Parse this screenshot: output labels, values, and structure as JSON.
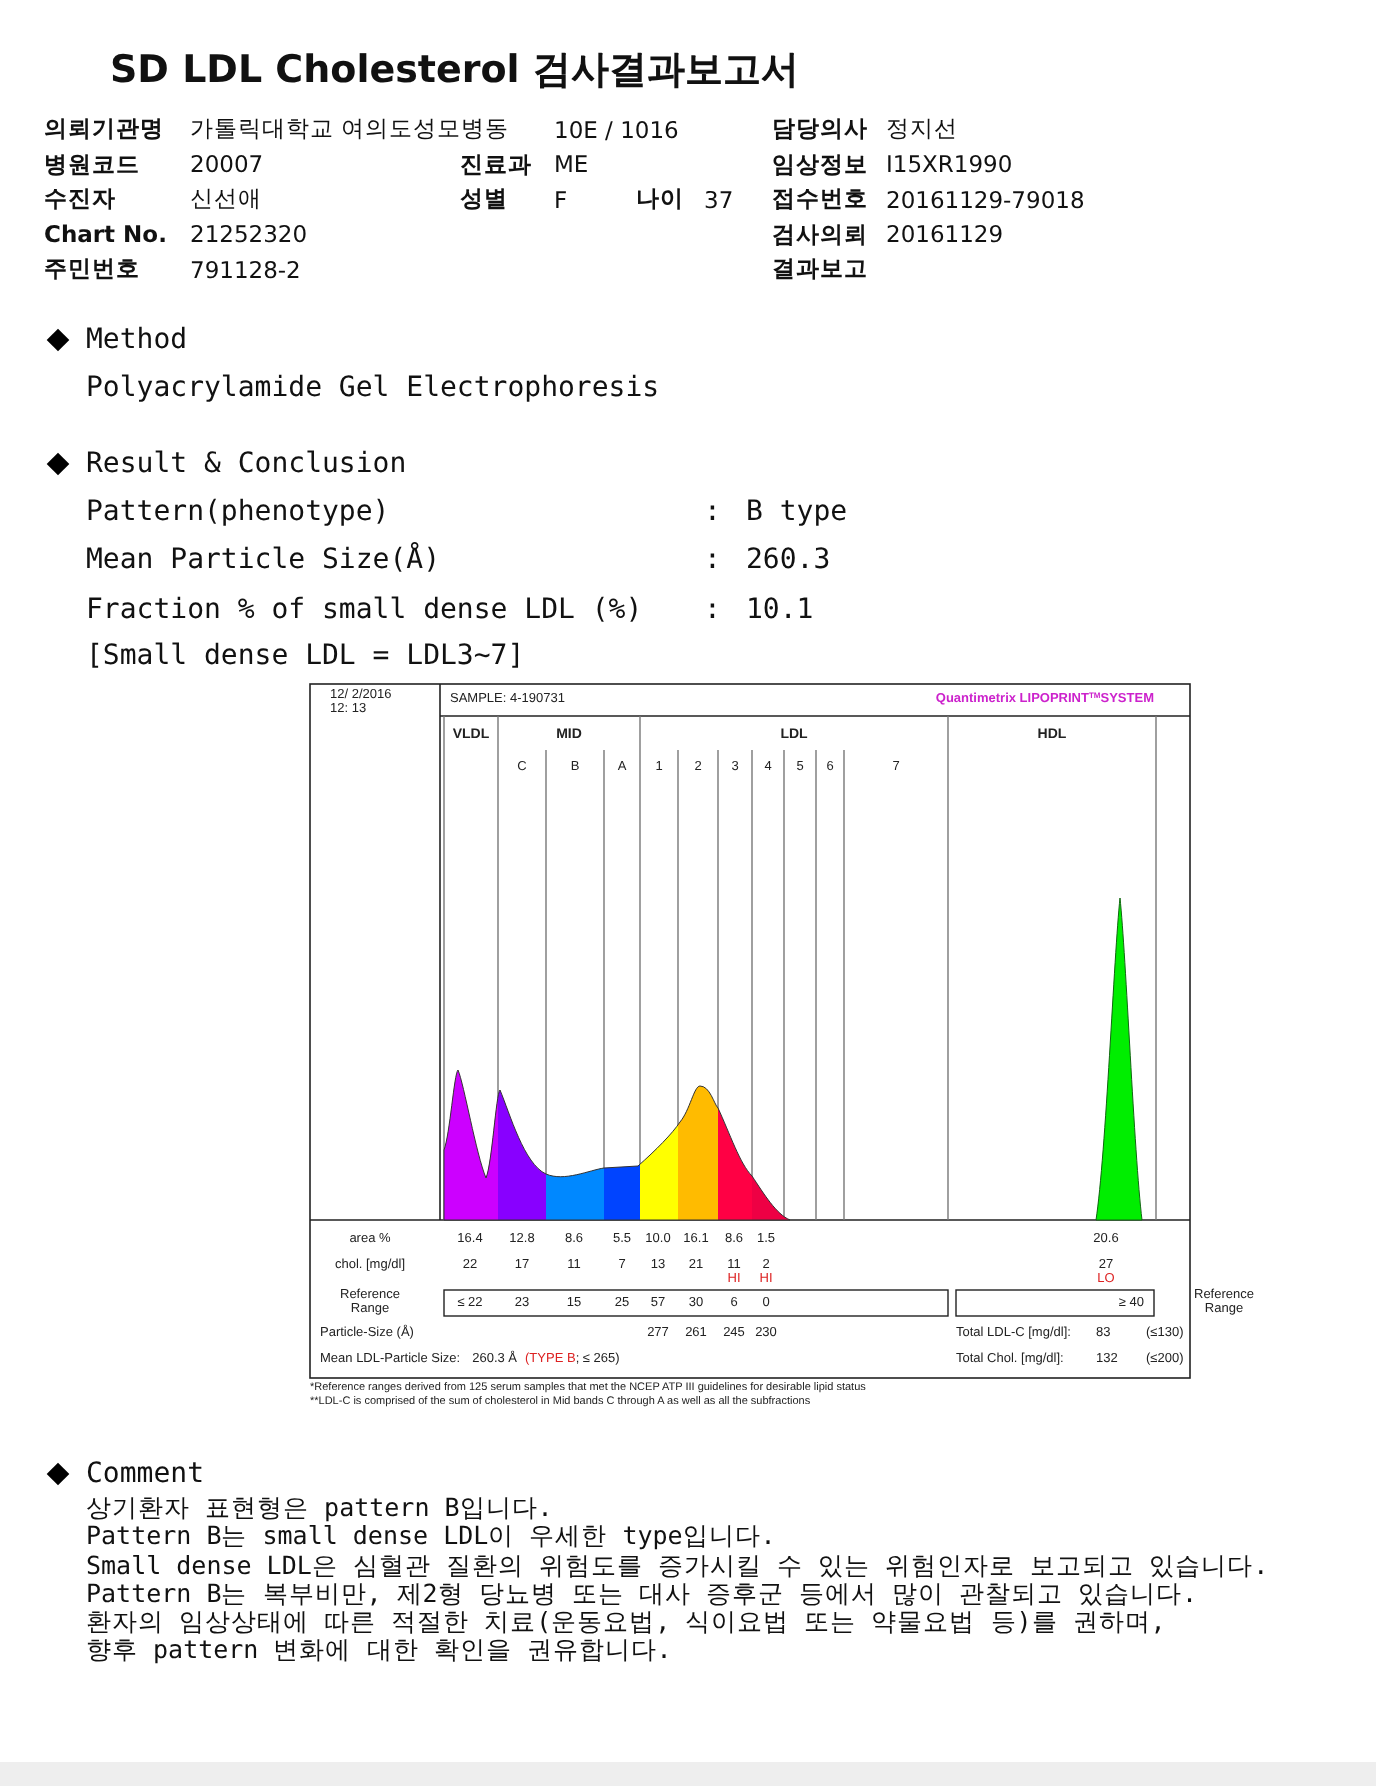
{
  "title": "SD LDL Cholesterol 검사결과보고서",
  "info": [
    {
      "left": {
        "label": "의뢰기관명",
        "value": "가톨릭대학교 여의도성모병동"
      },
      "middle": {
        "value": "10E / 1016"
      },
      "right": {
        "label": "담당의사",
        "value": "정지선"
      }
    },
    {
      "left": {
        "label": "병원코드",
        "value": "20007"
      },
      "middle": {
        "label": "진료과",
        "value": "ME"
      },
      "right": {
        "label": "임상정보",
        "value": "I15XR1990"
      }
    },
    {
      "left": {
        "label": "수진자",
        "value": "신선애"
      },
      "middle": {
        "label": "성별",
        "value": "F"
      },
      "age": {
        "label": "나이",
        "value": "37"
      },
      "right": {
        "label": "접수번호",
        "value": "20161129-79018"
      }
    },
    {
      "left": {
        "label": "Chart No.",
        "value": "21252320"
      },
      "right": {
        "label": "검사의뢰",
        "value": "20161129"
      }
    },
    {
      "left": {
        "label": "주민번호",
        "value": "791128-2"
      },
      "right": {
        "label": "결과보고"
      }
    }
  ],
  "method": {
    "heading": "Method",
    "text": "Polyacrylamide Gel Electrophoresis"
  },
  "result": {
    "heading": "Result & Conclusion",
    "items": [
      {
        "label": "Pattern(phenotype)",
        "separator": ":",
        "value": "B type"
      },
      {
        "label": "Mean Particle Size(Å)",
        "separator": ":",
        "value": "260.3"
      },
      {
        "label": "Fraction % of small dense LDL (%)",
        "separator": ":",
        "value": "10.1"
      }
    ],
    "note": "[Small dense LDL = LDL3~7]"
  },
  "chart": {
    "date": "12/ 2/2016",
    "time": "12: 13",
    "sample": "SAMPLE:  4-190731",
    "brand": "Quantimetrix LIPOPRINT",
    "brand_mark": "TM",
    "brand_suffix": "SYSTEM",
    "groups": [
      {
        "label": "VLDL"
      },
      {
        "label": "MID",
        "subbands": [
          "C",
          "B",
          "A"
        ]
      },
      {
        "label": "LDL",
        "subbands": [
          "1",
          "2",
          "3",
          "4",
          "5",
          "6",
          "7"
        ]
      },
      {
        "label": "HDL"
      }
    ],
    "rows": [
      {
        "kind": "values",
        "label": "area %",
        "cells": [
          {
            "value": "16.4"
          },
          {
            "value": "12.8"
          },
          {
            "value": "8.6"
          },
          {
            "value": "5.5"
          },
          {
            "value": "10.0"
          },
          {
            "value": "16.1"
          },
          {
            "value": "8.6"
          },
          {
            "value": "1.5"
          }
        ],
        "hdl": {
          "value": "20.6"
        }
      },
      {
        "kind": "values",
        "label": "chol. [mg/dl]",
        "cells": [
          {
            "value": "22"
          },
          {
            "value": "17"
          },
          {
            "value": "11"
          },
          {
            "value": "7"
          },
          {
            "value": "13"
          },
          {
            "value": "21"
          },
          {
            "value": "11",
            "flag": "HI"
          },
          {
            "value": "2",
            "flag": "HI"
          }
        ],
        "hdl": {
          "value": "27",
          "flag": "LO"
        }
      },
      {
        "kind": "range",
        "label_lines": [
          "Reference",
          "Range"
        ],
        "cells": [
          {
            "value": "≤ 22"
          },
          {
            "value": "23"
          },
          {
            "value": "15"
          },
          {
            "value": "25"
          },
          {
            "value": "57"
          },
          {
            "value": "30"
          },
          {
            "value": "6"
          },
          {
            "value": "0"
          }
        ],
        "hdl": {
          "value": "≥ 40"
        },
        "right_label_lines": [
          "Reference",
          "Range"
        ]
      },
      {
        "kind": "values",
        "label": "Particle-Size (Å)",
        "cells": [
          {},
          {},
          {},
          {},
          {
            "value": "277"
          },
          {
            "value": "261"
          },
          {
            "value": "245"
          },
          {
            "value": "230"
          }
        ]
      }
    ],
    "totals": [
      {
        "label": "Total LDL-C [mg/dl]:",
        "value": "83",
        "limit": "(≤130)"
      },
      {
        "label": "Total Chol. [mg/dl]:",
        "value": "132",
        "limit": "(≤200)"
      }
    ],
    "mean": {
      "label": "Mean LDL-Particle Size:",
      "value": "260.3 Å",
      "flag": "(TYPE B",
      "rest": "; ≤ 265)"
    },
    "footnotes": [
      "*Reference ranges derived from 125 serum samples that met the NCEP ATP III guidelines for desirable lipid status",
      "**LDL-C is comprised of the sum of cholesterol in Mid bands C through A as well as all the subfractions"
    ]
  },
  "comment": {
    "heading": "Comment",
    "lines": [
      "상기환자 표현형은 pattern B입니다.",
      "Pattern B는 small dense LDL이 우세한 type입니다.",
      "Small dense LDL은 심혈관 질환의 위험도를 증가시킬 수 있는 위험인자로 보고되고 있습니다.",
      "Pattern B는 복부비만, 제2형 당뇨병 또는 대사 증후군 등에서 많이 관찰되고 있습니다.",
      "환자의 임상상태에 따른 적절한 치료(운동요법, 식이요법 또는 약물요법 등)를 권하며,",
      "향후 pattern 변화에 대한 확인을 권유합니다."
    ]
  }
}
